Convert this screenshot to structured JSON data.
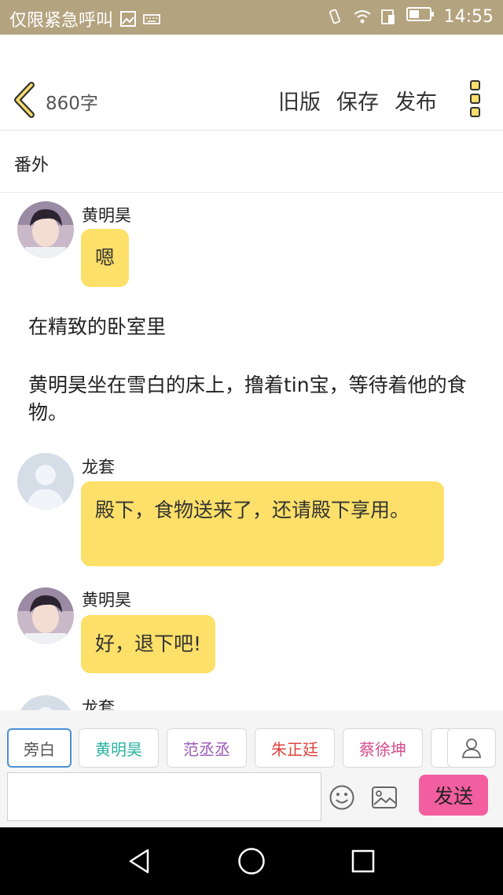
{
  "status_bar": {
    "carrier_text": "仅限紧急呼叫",
    "time": "14:55"
  },
  "header": {
    "word_count": "860字",
    "buttons": {
      "old_version": "旧版",
      "save": "保存",
      "publish": "发布"
    }
  },
  "chapter": {
    "title": "番外"
  },
  "messages": [
    {
      "speaker": "黄明昊",
      "text": "嗯"
    },
    {
      "narration": "在精致的卧室里"
    },
    {
      "narration": "黄明昊坐在雪白的床上，撸着tin宝，等待着他的食物。"
    },
    {
      "speaker": "龙套",
      "text": "殿下，食物送来了，还请殿下享用。"
    },
    {
      "speaker": "黄明昊",
      "text": "好，退下吧!"
    },
    {
      "speaker": "龙套"
    }
  ],
  "character_chips": [
    {
      "label": "旁白",
      "color": "#555555"
    },
    {
      "label": "黄明昊",
      "color": "#2bb3a0"
    },
    {
      "label": "范丞丞",
      "color": "#9b59b6"
    },
    {
      "label": "朱正廷",
      "color": "#e0443e"
    },
    {
      "label": "蔡徐坤",
      "color": "#d44d8c"
    }
  ],
  "composer": {
    "input_value": "",
    "send_label": "发送"
  },
  "colors": {
    "status_bar": "#b4a37f",
    "bubble": "#fde069",
    "send_button": "#f35ea0",
    "accent_yellow": "#fbde6b"
  }
}
